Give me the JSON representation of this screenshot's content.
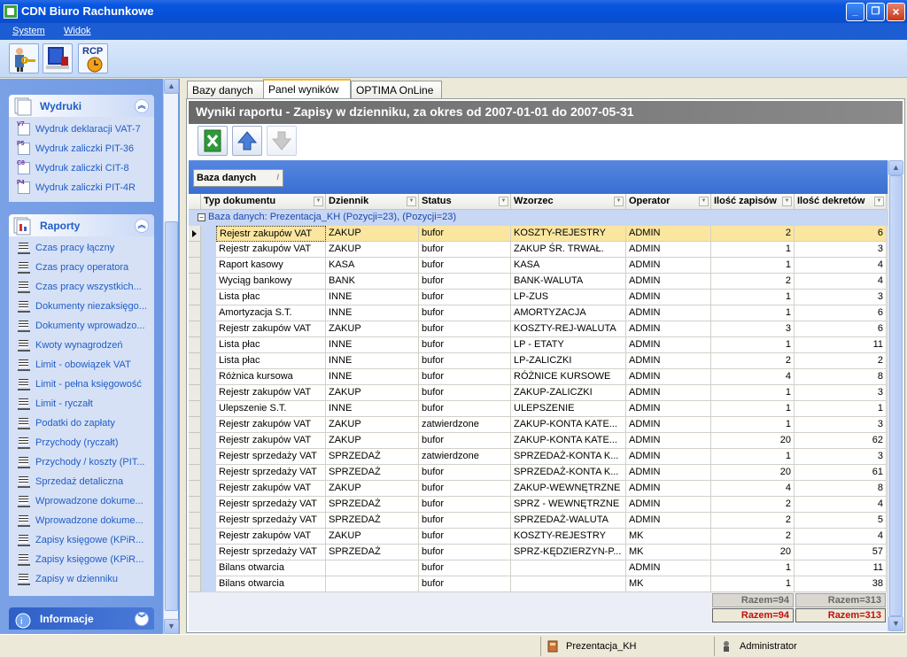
{
  "window": {
    "title": "CDN Biuro Rachunkowe"
  },
  "menu": {
    "system": "System",
    "view": "Widok"
  },
  "toolbar": {
    "btn1_icon": "user-key-icon",
    "btn2_icon": "monitor-icon",
    "btn3_label": "RCP"
  },
  "sidebar": {
    "sections": [
      {
        "title": "Wydruki",
        "items": [
          "Wydruk deklaracji VAT-7",
          "Wydruk zaliczki PIT-36",
          "Wydruk zaliczki CIT-8",
          "Wydruk zaliczki PIT-4R"
        ],
        "prefixes": [
          "V7",
          "P5",
          "C8",
          "P4"
        ]
      },
      {
        "title": "Raporty",
        "items": [
          "Czas pracy łączny",
          "Czas pracy operatora",
          "Czas pracy wszystkich...",
          "Dokumenty niezaksięgo...",
          "Dokumenty wprowadzo...",
          "Kwoty wynagrodzeń",
          "Limit - obowiązek VAT",
          "Limit - pełna księgowość",
          "Limit - ryczałt",
          "Podatki do zapłaty",
          "Przychody (ryczałt)",
          "Przychody / koszty (PIT...",
          "Sprzedaż detaliczna",
          "Wprowadzone dokume...",
          "Wprowadzone dokume...",
          "Zapisy księgowe (KPiR...",
          "Zapisy księgowe (KPiR...",
          "Zapisy w dzienniku"
        ]
      },
      {
        "title": "Informacje"
      }
    ]
  },
  "tabs": [
    "Bazy danych",
    "Panel wyników",
    "OPTIMA OnLine"
  ],
  "report": {
    "title": "Wyniki raportu - Zapisy w dzienniku, za okres od 2007-01-01 do 2007-05-31",
    "group_chip": "Baza danych",
    "group_row": "Baza danych: Prezentacja_KH (Pozycji=23), (Pozycji=23)",
    "columns": [
      "Typ dokumentu",
      "Dziennik",
      "Status",
      "Wzorzec",
      "Operator",
      "Ilość zapisów",
      "Ilość dekretów"
    ],
    "rows": [
      [
        "Rejestr zakupów VAT",
        "ZAKUP",
        "bufor",
        "KOSZTY-REJESTRY",
        "ADMIN",
        "2",
        "6"
      ],
      [
        "Rejestr zakupów VAT",
        "ZAKUP",
        "bufor",
        "ZAKUP ŚR. TRWAŁ.",
        "ADMIN",
        "1",
        "3"
      ],
      [
        "Raport kasowy",
        "KASA",
        "bufor",
        "KASA",
        "ADMIN",
        "1",
        "4"
      ],
      [
        "Wyciąg bankowy",
        "BANK",
        "bufor",
        "BANK-WALUTA",
        "ADMIN",
        "2",
        "4"
      ],
      [
        "Lista płac",
        "INNE",
        "bufor",
        "LP-ZUS",
        "ADMIN",
        "1",
        "3"
      ],
      [
        "Amortyzacja S.T.",
        "INNE",
        "bufor",
        "AMORTYZACJA",
        "ADMIN",
        "1",
        "6"
      ],
      [
        "Rejestr zakupów VAT",
        "ZAKUP",
        "bufor",
        "KOSZTY-REJ-WALUTA",
        "ADMIN",
        "3",
        "6"
      ],
      [
        "Lista płac",
        "INNE",
        "bufor",
        "LP - ETATY",
        "ADMIN",
        "1",
        "11"
      ],
      [
        "Lista płac",
        "INNE",
        "bufor",
        "LP-ZALICZKI",
        "ADMIN",
        "2",
        "2"
      ],
      [
        "Różnica kursowa",
        "INNE",
        "bufor",
        "RÓŻNICE KURSOWE",
        "ADMIN",
        "4",
        "8"
      ],
      [
        "Rejestr zakupów VAT",
        "ZAKUP",
        "bufor",
        "ZAKUP-ZALICZKI",
        "ADMIN",
        "1",
        "3"
      ],
      [
        "Ulepszenie S.T.",
        "INNE",
        "bufor",
        "ULEPSZENIE",
        "ADMIN",
        "1",
        "1"
      ],
      [
        "Rejestr zakupów VAT",
        "ZAKUP",
        "zatwierdzone",
        "ZAKUP-KONTA KATE...",
        "ADMIN",
        "1",
        "3"
      ],
      [
        "Rejestr zakupów VAT",
        "ZAKUP",
        "bufor",
        "ZAKUP-KONTA KATE...",
        "ADMIN",
        "20",
        "62"
      ],
      [
        "Rejestr sprzedaży VAT",
        "SPRZEDAŻ",
        "zatwierdzone",
        "SPRZEDAŻ-KONTA K...",
        "ADMIN",
        "1",
        "3"
      ],
      [
        "Rejestr sprzedaży VAT",
        "SPRZEDAŻ",
        "bufor",
        "SPRZEDAŻ-KONTA K...",
        "ADMIN",
        "20",
        "61"
      ],
      [
        "Rejestr zakupów VAT",
        "ZAKUP",
        "bufor",
        "ZAKUP-WEWNĘTRZNE",
        "ADMIN",
        "4",
        "8"
      ],
      [
        "Rejestr sprzedaży VAT",
        "SPRZEDAŻ",
        "bufor",
        "SPRZ - WEWNĘTRZNE",
        "ADMIN",
        "2",
        "4"
      ],
      [
        "Rejestr sprzedaży VAT",
        "SPRZEDAŻ",
        "bufor",
        "SPRZEDAŻ-WALUTA",
        "ADMIN",
        "2",
        "5"
      ],
      [
        "Rejestr zakupów VAT",
        "ZAKUP",
        "bufor",
        "KOSZTY-REJESTRY",
        "MK",
        "2",
        "4"
      ],
      [
        "Rejestr sprzedaży VAT",
        "SPRZEDAŻ",
        "bufor",
        "SPRZ-KĘDZIERZYN-P...",
        "MK",
        "20",
        "57"
      ],
      [
        "Bilans otwarcia",
        "",
        "bufor",
        "",
        "ADMIN",
        "1",
        "11"
      ],
      [
        "Bilans otwarcia",
        "",
        "bufor",
        "",
        "MK",
        "1",
        "38"
      ]
    ],
    "group_totals": [
      "Razem=94",
      "Razem=313"
    ],
    "grand_totals": [
      "Razem=94",
      "Razem=313"
    ]
  },
  "statusbar": {
    "database": "Prezentacja_KH",
    "operator": "Administrator"
  }
}
